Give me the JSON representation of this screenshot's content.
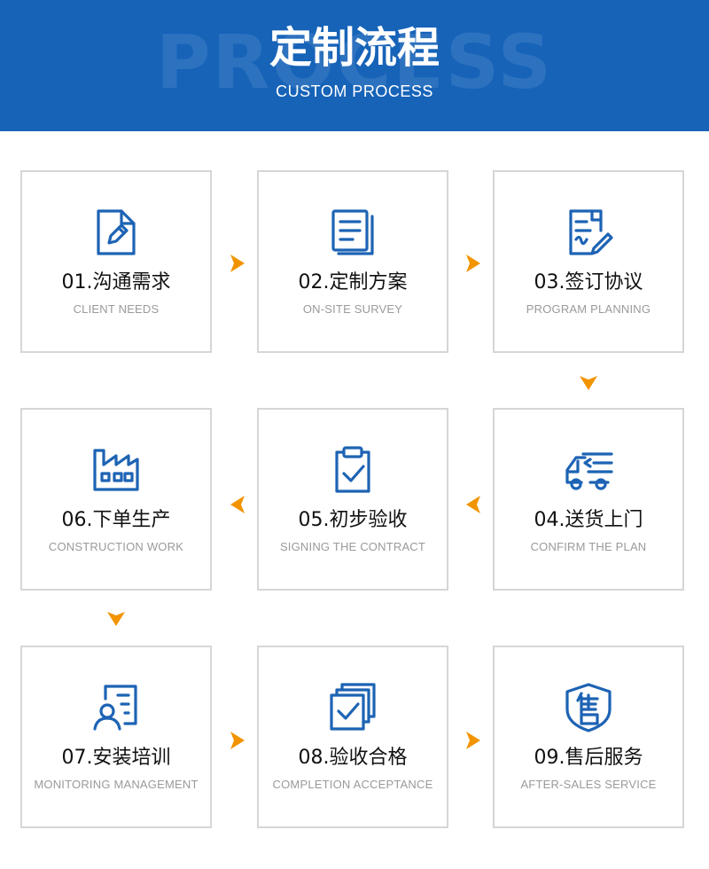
{
  "header": {
    "title": "定制流程",
    "subtitle": "CUSTOM PROCESS",
    "bg_word": "PROCESS"
  },
  "colors": {
    "banner": "#1663b8",
    "icon_blue": "#1d63b4",
    "arrow_orange": "#f29400",
    "card_border": "#d6d6d6"
  },
  "steps": [
    {
      "title": "01.沟通需求",
      "subtitle": "CLIENT NEEDS",
      "icon": "document-edit-icon"
    },
    {
      "title": "02.定制方案",
      "subtitle": "ON-SITE SURVEY",
      "icon": "document-list-icon"
    },
    {
      "title": "03.签订协议",
      "subtitle": "PROGRAM PLANNING",
      "icon": "contract-sign-icon"
    },
    {
      "title": "04.送货上门",
      "subtitle": "CONFIRM THE PLAN",
      "icon": "delivery-truck-icon"
    },
    {
      "title": "05.初步验收",
      "subtitle": "SIGNING THE CONTRACT",
      "icon": "clipboard-check-icon"
    },
    {
      "title": "06.下单生产",
      "subtitle": "CONSTRUCTION WORK",
      "icon": "factory-icon"
    },
    {
      "title": "07.安装培训",
      "subtitle": "MONITORING MANAGEMENT",
      "icon": "user-training-icon"
    },
    {
      "title": "08.验收合格",
      "subtitle": "COMPLETION ACCEPTANCE",
      "icon": "check-documents-icon"
    },
    {
      "title": "09.售后服务",
      "subtitle": "AFTER-SALES SERVICE",
      "icon": "after-sales-shield-icon"
    }
  ]
}
